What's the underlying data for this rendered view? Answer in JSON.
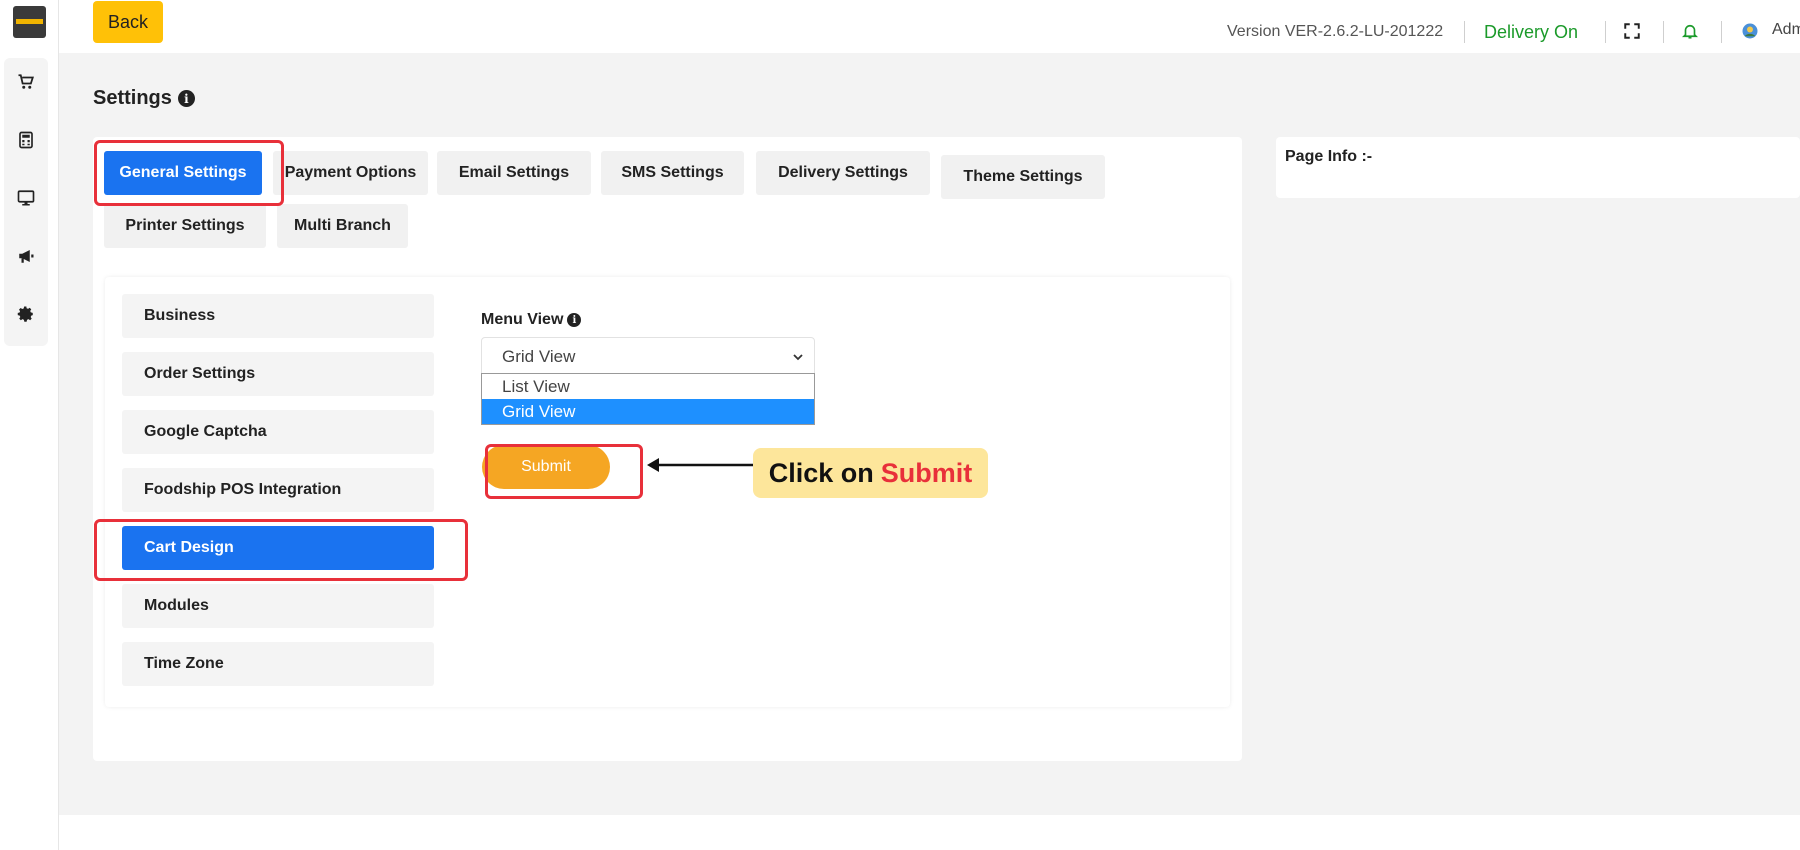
{
  "app": {
    "brand_color": "#1a73f0",
    "accent_color": "#ffc107"
  },
  "sidebar": {
    "items": [
      {
        "icon": "cart-icon"
      },
      {
        "icon": "calculator-icon"
      },
      {
        "icon": "monitor-icon"
      },
      {
        "icon": "megaphone-icon"
      },
      {
        "icon": "gear-icon"
      }
    ]
  },
  "header": {
    "back_label": "Back",
    "version": "Version VER-2.6.2-LU-201222",
    "delivery_status": "Delivery On",
    "user_label": "Adm"
  },
  "page": {
    "title": "Settings",
    "tabs": [
      {
        "label": "General Settings",
        "active": true
      },
      {
        "label": "Payment Options"
      },
      {
        "label": "Email Settings"
      },
      {
        "label": "SMS Settings"
      },
      {
        "label": "Delivery Settings"
      },
      {
        "label": "Theme Settings"
      },
      {
        "label": "Printer Settings"
      },
      {
        "label": "Multi Branch"
      }
    ],
    "side_menu": [
      {
        "label": "Business"
      },
      {
        "label": "Order Settings"
      },
      {
        "label": "Google Captcha"
      },
      {
        "label": "Foodship POS Integration"
      },
      {
        "label": "Cart Design",
        "active": true
      },
      {
        "label": "Modules"
      },
      {
        "label": "Time Zone"
      }
    ],
    "form": {
      "label": "Menu View",
      "selected": "Grid View",
      "options": [
        "List View",
        "Grid View"
      ],
      "submit_label": "Submit"
    },
    "page_info_label": "Page Info :-"
  },
  "annotation": {
    "text": "Click on",
    "highlight": "Submit"
  }
}
